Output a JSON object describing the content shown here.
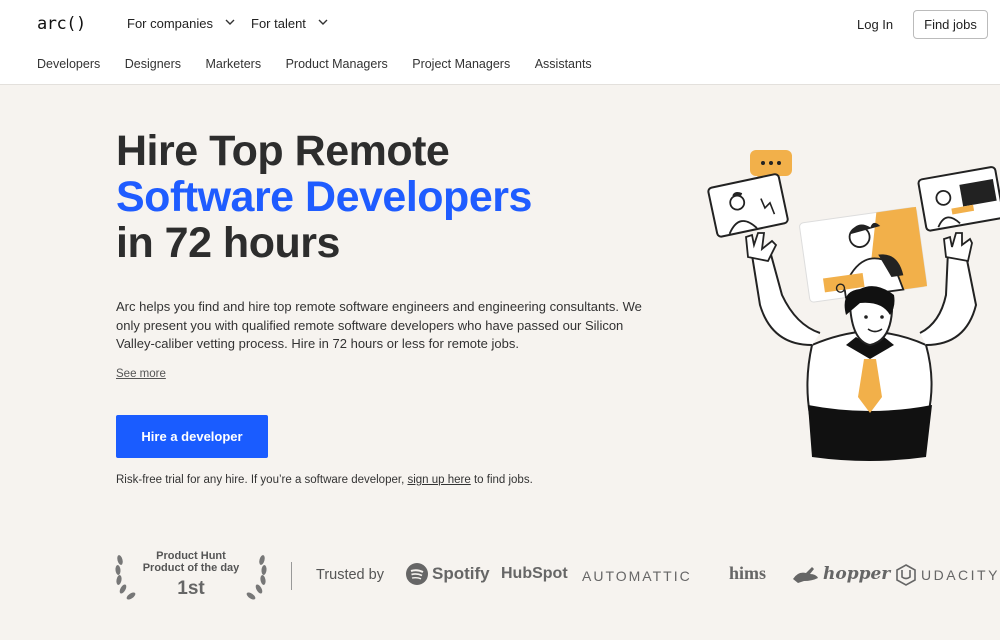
{
  "header": {
    "logo": "arc()",
    "nav": [
      {
        "label": "For companies"
      },
      {
        "label": "For talent"
      }
    ],
    "login": "Log In",
    "find_jobs": "Find jobs"
  },
  "subnav": [
    "Developers",
    "Designers",
    "Marketers",
    "Product Managers",
    "Project Managers",
    "Assistants"
  ],
  "hero": {
    "line1": "Hire Top Remote",
    "line2": "Software Developers",
    "line3": "in 72 hours",
    "description": "Arc helps you find and hire top remote software engineers and engineering consultants. We only present you with qualified remote software developers who have passed our Silicon Valley-caliber vetting process. Hire in 72 hours or less for remote jobs.",
    "see_more": "See more",
    "cta": "Hire a developer",
    "risk_prefix": "Risk-free trial for any hire. If you’re a software developer, ",
    "risk_link": "sign up here",
    "risk_suffix": " to find jobs."
  },
  "badge": {
    "line1": "Product Hunt",
    "line2": "Product of the day",
    "rank": "1st"
  },
  "trusted": {
    "label": "Trusted by",
    "brands": [
      "Spotify",
      "HubSpot",
      "AUTOMATTIC",
      "hims",
      "hopper",
      "UDACITY"
    ]
  },
  "colors": {
    "accent": "#1f5cff",
    "illustration_accent": "#f2b04a"
  }
}
